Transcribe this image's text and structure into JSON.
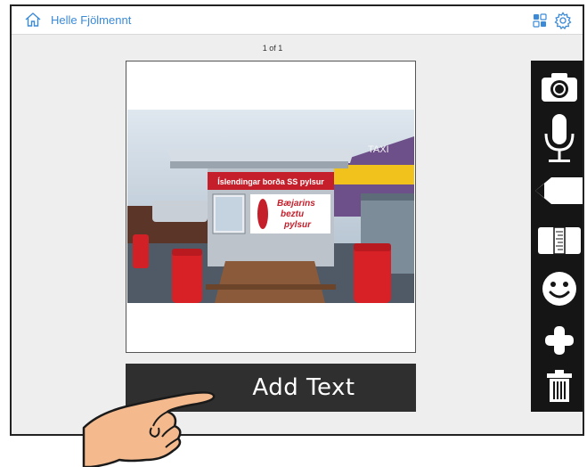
{
  "header": {
    "owner_name": "Helle Fjölmennt",
    "home_icon": "home-icon",
    "view_icon": "grid-view-icon",
    "settings_icon": "gear-icon"
  },
  "page": {
    "counter": "1 of 1"
  },
  "photo": {
    "sign_banner": "Íslendingar borða SS pylsur",
    "sign_slogan_line1": "Bæjarins",
    "sign_slogan_line2": "beztu",
    "sign_slogan_line3": "pylsur",
    "taxi_text": "TAXI"
  },
  "add_text": {
    "label": "Add Text"
  },
  "toolbar": {
    "tools": [
      "camera-icon",
      "microphone-icon",
      "pencil-icon",
      "ruler-icon",
      "smiley-icon",
      "plus-icon",
      "trash-icon"
    ]
  },
  "colors": {
    "accent": "#3a8ad8",
    "toolbar": "#151515",
    "add_text_bar": "#2f2f2f",
    "background": "#eeeeee"
  }
}
